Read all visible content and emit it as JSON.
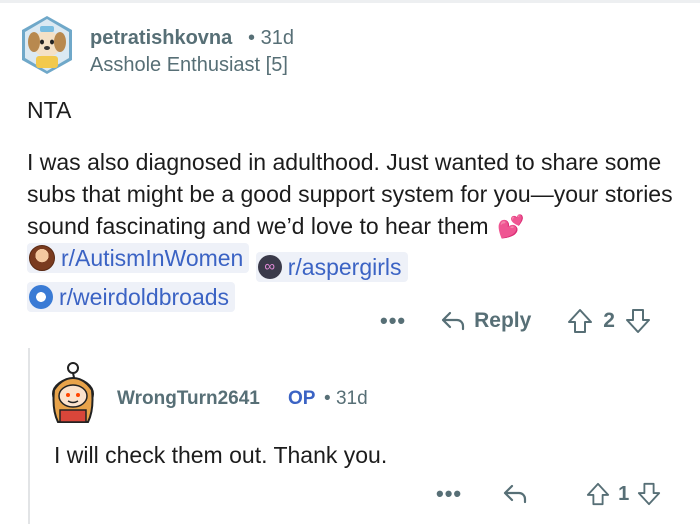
{
  "parent_comment": {
    "username": "petratishkovna",
    "separator": "•",
    "age": "31d",
    "flair": "Asshole Enthusiast [5]",
    "verdict": "NTA",
    "text_part1": "I was also diagnosed in adulthood. Just wanted to share some subs that might be a good support system for you—your stories sound fascinating and we’d love to hear them",
    "emoji": "💕",
    "links": [
      {
        "label": "r/AutismInWomen",
        "icon": "subreddit-avatar-icon"
      },
      {
        "label": "r/aspergirls",
        "icon": "infinity-icon"
      },
      {
        "label": "r/weirdoldbroads",
        "icon": "planet-icon"
      }
    ],
    "actions": {
      "more": "•••",
      "reply": "Reply",
      "score": "2"
    }
  },
  "reply_comment": {
    "username": "WrongTurn2641",
    "op_badge": "OP",
    "separator": "•",
    "age": "31d",
    "text": "I will check them out.  Thank you.",
    "actions": {
      "more": "•••",
      "score": "1"
    }
  },
  "colors": {
    "meta_gray": "#576f76",
    "link_blue": "#3b63c4",
    "link_bg": "#eef1f8"
  }
}
